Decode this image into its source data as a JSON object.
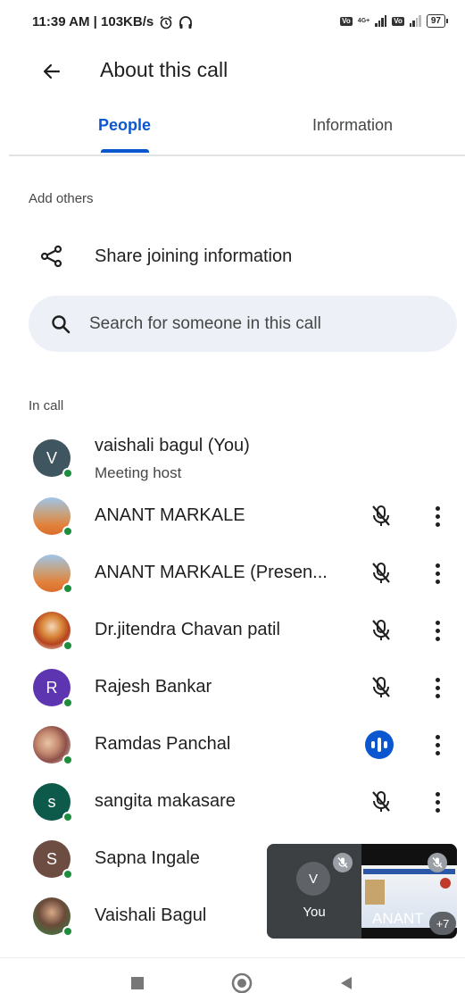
{
  "status_bar": {
    "time_speed": "11:39 AM | 103KB/s",
    "network_tag": "4G+",
    "battery": "97"
  },
  "header": {
    "title": "About this call"
  },
  "tabs": [
    {
      "label": "People",
      "selected": true
    },
    {
      "label": "Information",
      "selected": false
    }
  ],
  "add_others": {
    "label": "Add others",
    "share_label": "Share joining information"
  },
  "search": {
    "placeholder": "Search for someone in this call"
  },
  "in_call": {
    "label": "In call",
    "people": [
      {
        "name": "vaishali bagul (You)",
        "subtitle": "Meeting host",
        "avatar_letter": "V",
        "avatar_color": "#3f5560",
        "mic": "none"
      },
      {
        "name": "ANANT MARKALE",
        "avatar_type": "photo",
        "mic": "muted"
      },
      {
        "name": "ANANT MARKALE (Presen...",
        "avatar_type": "photo",
        "mic": "muted"
      },
      {
        "name": "Dr.jitendra Chavan patil",
        "avatar_type": "photo",
        "mic": "muted"
      },
      {
        "name": "Rajesh Bankar",
        "avatar_letter": "R",
        "avatar_color": "#5e35b1",
        "mic": "muted"
      },
      {
        "name": "Ramdas Panchal",
        "avatar_type": "photo",
        "mic": "speaking"
      },
      {
        "name": "sangita makasare",
        "avatar_letter": "s",
        "avatar_color": "#0d5a4a",
        "mic": "muted"
      },
      {
        "name": "Sapna Ingale",
        "avatar_letter": "S",
        "avatar_color": "#6d4c41",
        "mic": "hidden"
      },
      {
        "name": "Vaishali Bagul",
        "avatar_type": "photo",
        "mic": "hidden"
      }
    ]
  },
  "pip": {
    "self_letter": "V",
    "self_label": "You",
    "other_name": "ANANT",
    "extra_count": "+7"
  },
  "colors": {
    "accent": "#0b57d0",
    "presence": "#1e8e3e",
    "search_bg": "#edf1f7"
  }
}
